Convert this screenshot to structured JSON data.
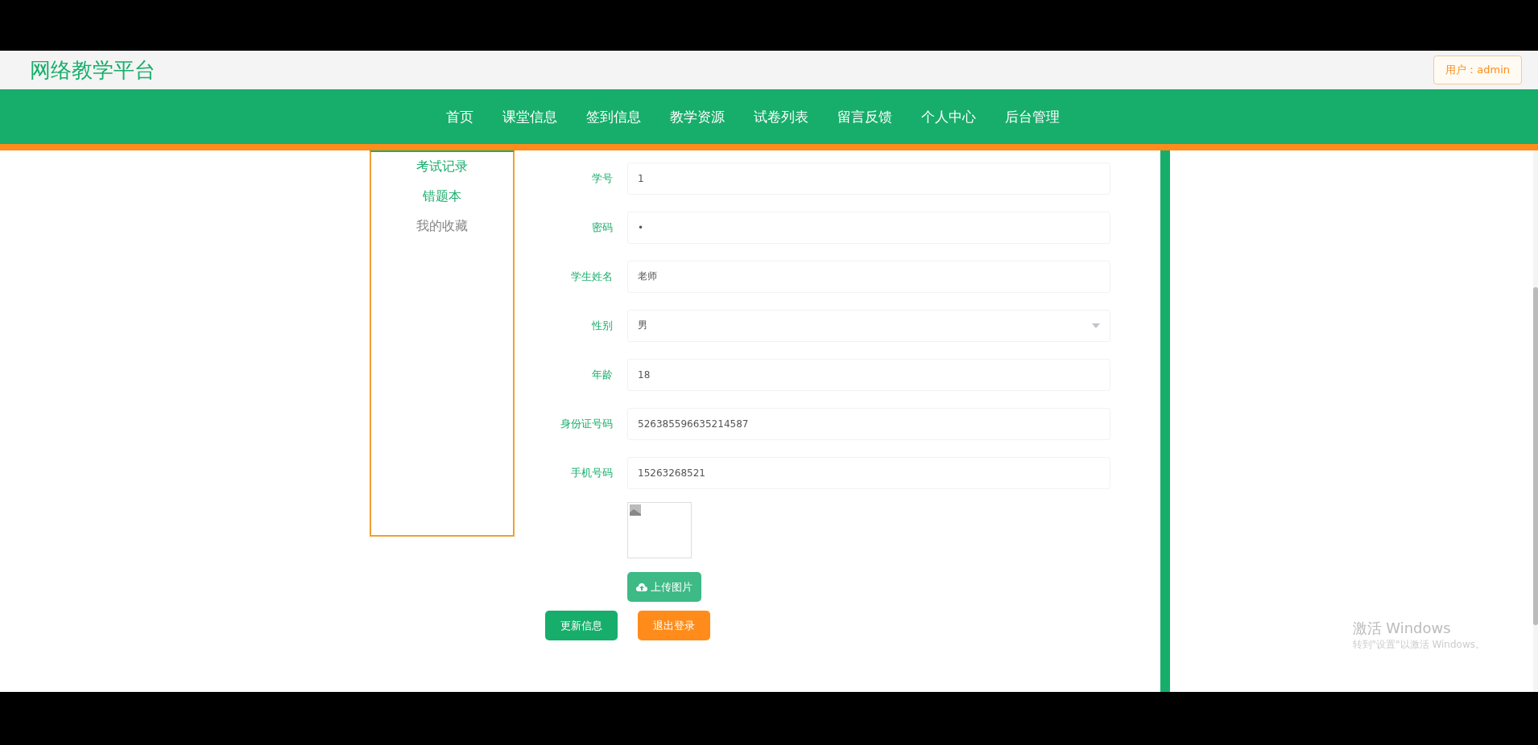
{
  "site_title": "网络教学平台",
  "user_badge": "用户：admin",
  "nav": [
    {
      "label": "首页"
    },
    {
      "label": "课堂信息"
    },
    {
      "label": "签到信息"
    },
    {
      "label": "教学资源"
    },
    {
      "label": "试卷列表"
    },
    {
      "label": "留言反馈"
    },
    {
      "label": "个人中心"
    },
    {
      "label": "后台管理"
    }
  ],
  "sidebar": {
    "items": [
      {
        "label": "考试记录"
      },
      {
        "label": "错题本"
      },
      {
        "label": "我的收藏"
      }
    ]
  },
  "form": {
    "fields": [
      {
        "kind": "text",
        "label": "学号",
        "value": "1"
      },
      {
        "kind": "password",
        "label": "密码",
        "value": "•"
      },
      {
        "kind": "text",
        "label": "学生姓名",
        "value": "老师"
      },
      {
        "kind": "select",
        "label": "性别",
        "value": "男"
      },
      {
        "kind": "text",
        "label": "年龄",
        "value": "18"
      },
      {
        "kind": "text",
        "label": "身份证号码",
        "value": "526385596635214587"
      },
      {
        "kind": "text",
        "label": "手机号码",
        "value": "15263268521"
      }
    ],
    "upload_button": "上传图片",
    "buttons": [
      {
        "label": "更新信息",
        "kind": "primary"
      },
      {
        "label": "退出登录",
        "kind": "warning"
      }
    ]
  },
  "os_watermark": {
    "title": "激活 Windows",
    "subtitle": "转到\"设置\"以激活 Windows。"
  }
}
